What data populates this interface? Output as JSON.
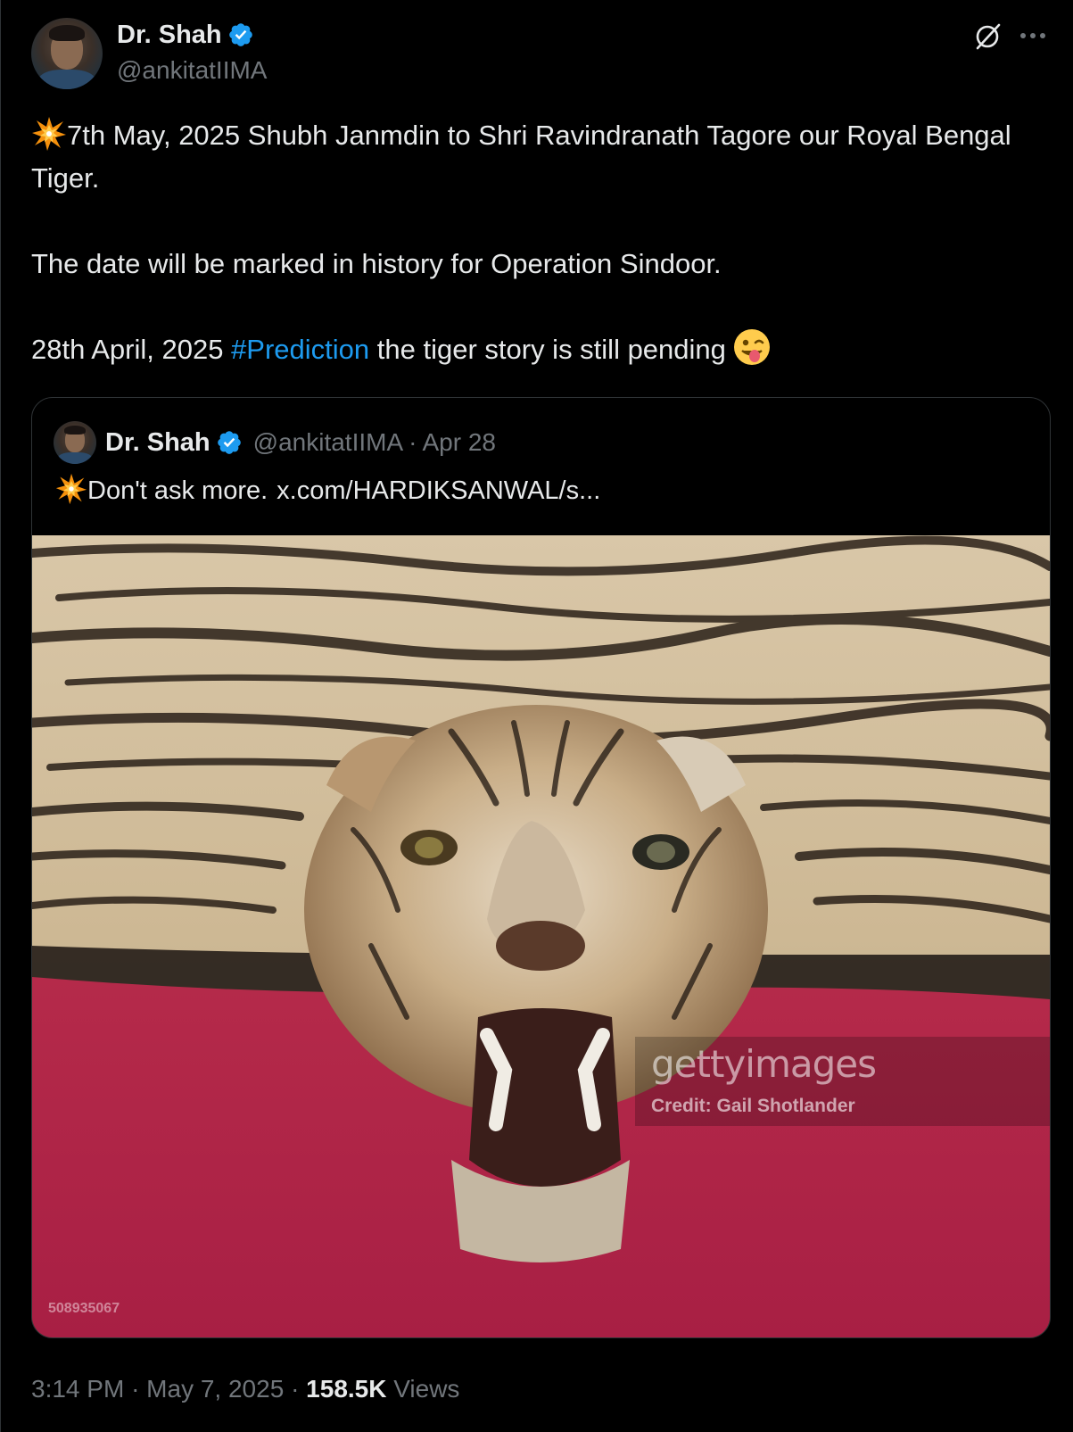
{
  "tweet": {
    "author": {
      "display_name": "Dr. Shah",
      "handle": "@ankitatIIMA",
      "verified": true
    },
    "icons": {
      "verified": "verified-badge-icon",
      "grok": "grok-icon",
      "more": "more-options-icon",
      "emoji_burst": "collision-emoji",
      "emoji_wink": "winking-face-tongue-emoji"
    },
    "body": {
      "line1": "7th May, 2025 Shubh Janmdin to Shri Ravindranath Tagore our Royal Bengal Tiger.",
      "line2": "The date will be marked in history for Operation Sindoor.",
      "line3_prefix": "28th April, 2025 ",
      "hashtag": "#Prediction",
      "line3_suffix": " the tiger story is still pending"
    },
    "quote": {
      "display_name": "Dr. Shah",
      "handle": "@ankitatIIMA",
      "separator": "·",
      "date": "Apr 28",
      "text": "Don't ask more.",
      "link": "x.com/HARDIKSANWAL/s...",
      "image": {
        "watermark_logo": "gettyimages",
        "watermark_credit": "Credit: Gail Shotlander",
        "image_id": "508935067"
      }
    },
    "meta": {
      "time": "3:14 PM",
      "separator": "·",
      "date": "May 7, 2025",
      "views_count": "158.5K",
      "views_label": "Views"
    },
    "colors": {
      "background": "#000000",
      "text": "#e7e9ea",
      "secondary_text": "#71767b",
      "link": "#1d9bf0",
      "border": "#2f3336",
      "verified": "#1d9bf0"
    }
  }
}
